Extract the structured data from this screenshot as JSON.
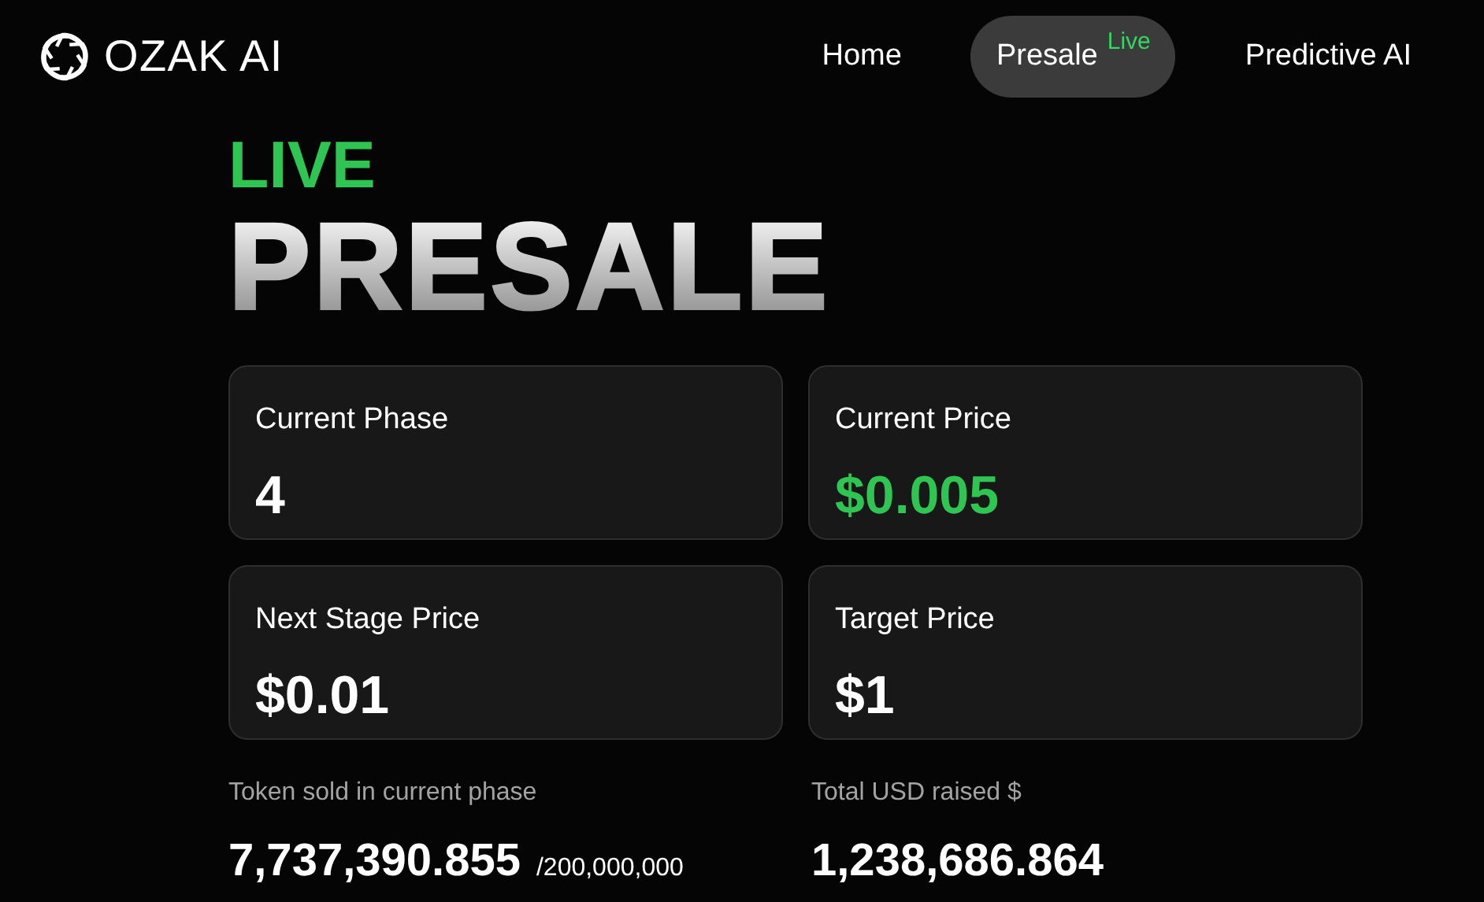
{
  "brand": {
    "name": "OZAK AI"
  },
  "nav": [
    {
      "label": "Home",
      "selected": false
    },
    {
      "label": "Presale",
      "selected": true,
      "badge": "Live"
    },
    {
      "label": "Predictive AI",
      "selected": false
    }
  ],
  "hero": {
    "eyebrow": "LIVE",
    "title": "PRESALE"
  },
  "stats": [
    {
      "label": "Current Phase",
      "value": "4",
      "highlighted": false
    },
    {
      "label": "Current Price",
      "value": "$0.005",
      "highlighted": true
    },
    {
      "label": "Next Stage Price",
      "value": "$0.01",
      "highlighted": false
    },
    {
      "label": "Target Price",
      "value": "$1",
      "highlighted": false
    }
  ],
  "totals": [
    {
      "label": "Token sold in current phase",
      "value": "7,737,390.855",
      "total": "/200,000,000"
    },
    {
      "label": "Total USD raised $",
      "value": "1,238,686.864"
    }
  ]
}
